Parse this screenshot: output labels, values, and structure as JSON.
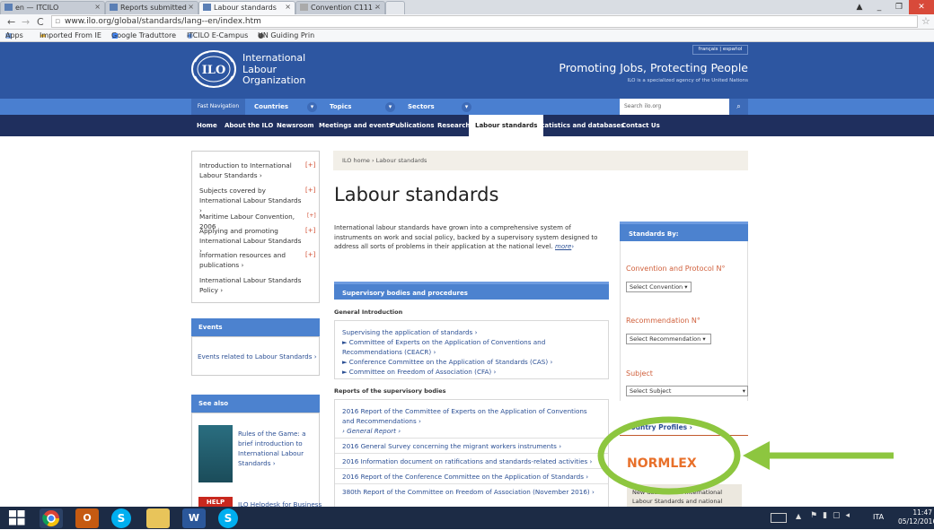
{
  "browser": {
    "tabs": [
      {
        "label": "en — ITCILO"
      },
      {
        "label": "Reports submitted"
      },
      {
        "label": "Labour standards"
      },
      {
        "label": "Convention C111 -"
      }
    ],
    "url": "www.ilo.org/global/standards/lang--en/index.htm",
    "bookmarks": [
      "Apps",
      "Imported From IE",
      "Google Traduttore",
      "ITCILO E-Campus",
      "UN Guiding Prin"
    ]
  },
  "header": {
    "org_name": [
      "International",
      "Labour",
      "Organization"
    ],
    "lang_links": [
      "français",
      "español"
    ],
    "tagline": "Promoting Jobs, Protecting People",
    "subtagline": "ILO is a specialized agency of the United Nations",
    "logo_text": "ILO"
  },
  "fast_nav": {
    "label": "Fast Navigation",
    "items": [
      "Countries",
      "Topics",
      "Sectors"
    ],
    "search_placeholder": "Search ilo.org"
  },
  "main_nav": [
    "Home",
    "About the ILO",
    "Newsroom",
    "Meetings and events",
    "Publications",
    "Research",
    "Labour standards",
    "Statistics and databases",
    "Contact Us"
  ],
  "sidebar": {
    "items": [
      {
        "label": "Introduction to International Labour Standards ›",
        "expand": "[+]"
      },
      {
        "label": "Subjects covered by International Labour Standards ›",
        "expand": "[+]"
      },
      {
        "label": "Maritime Labour Convention, 2006",
        "expand": "[+]"
      },
      {
        "label": "Applying and promoting International Labour Standards ›",
        "expand": "[+]"
      },
      {
        "label": "Information resources and publications ›",
        "expand": "[+]"
      },
      {
        "label": "International Labour Standards Policy ›",
        "expand": ""
      }
    ],
    "events_title": "Events",
    "events_link": "Events related to Labour Standards ›",
    "see_also_title": "See also",
    "see_also_items": [
      "Rules of the Game: a brief introduction to International Labour Standards ›",
      "ILO Helpdesk for Business"
    ],
    "book_badge": "HELP"
  },
  "main": {
    "breadcrumb": "ILO home › Labour standards",
    "title": "Labour standards",
    "intro": "International labour standards have grown into a comprehensive system of instruments on work and social policy, backed by a supervisory system designed to address all sorts of problems in their application at the national level.",
    "more": "more",
    "section_bar": "Supervisory bodies and procedures",
    "general_intro": "General Introduction",
    "gi_links": [
      "Supervising the application of standards ›",
      "► Committee of Experts on the Application of Conventions and Recommendations (CEACR) ›",
      "► Conference Committee on the Application of Standards (CAS) ›",
      "► Committee on Freedom of Association (CFA) ›"
    ],
    "reports_heading": "Reports of the supervisory bodies",
    "report_links": [
      "2016 Report of the Committee of Experts on the Application of Conventions and Recommendations ›",
      "2016 General Survey concerning the migrant workers instruments ›",
      "2016 Information document on ratifications and standards-related activities ›",
      "2016 Report of the Conference Committee on the Application of Standards ›",
      "380th Report of the Committee on Freedom of Association (November 2016) ›"
    ],
    "general_report": "› General Report ›"
  },
  "right": {
    "standards_by": "Standards By:",
    "conv_label": "Convention and Protocol N°",
    "conv_select": "Select Convention",
    "rec_label": "Recommendation N°",
    "rec_select": "Select Recommendation",
    "subject_label": "Subject",
    "subject_select": "Select Subject",
    "country_profiles": "Country Profiles ›",
    "normlex": "NORMLEX",
    "normlex_desc": "New database on International Labour Standards and national"
  },
  "taskbar": {
    "lang": "ITA",
    "time": "11:47",
    "date": "05/12/2016"
  },
  "colors": {
    "header_blue": "#2d56a1",
    "nav_dark": "#1f2f5e",
    "annotation_green": "#8dc63f",
    "normlex_orange": "#e8702a"
  }
}
